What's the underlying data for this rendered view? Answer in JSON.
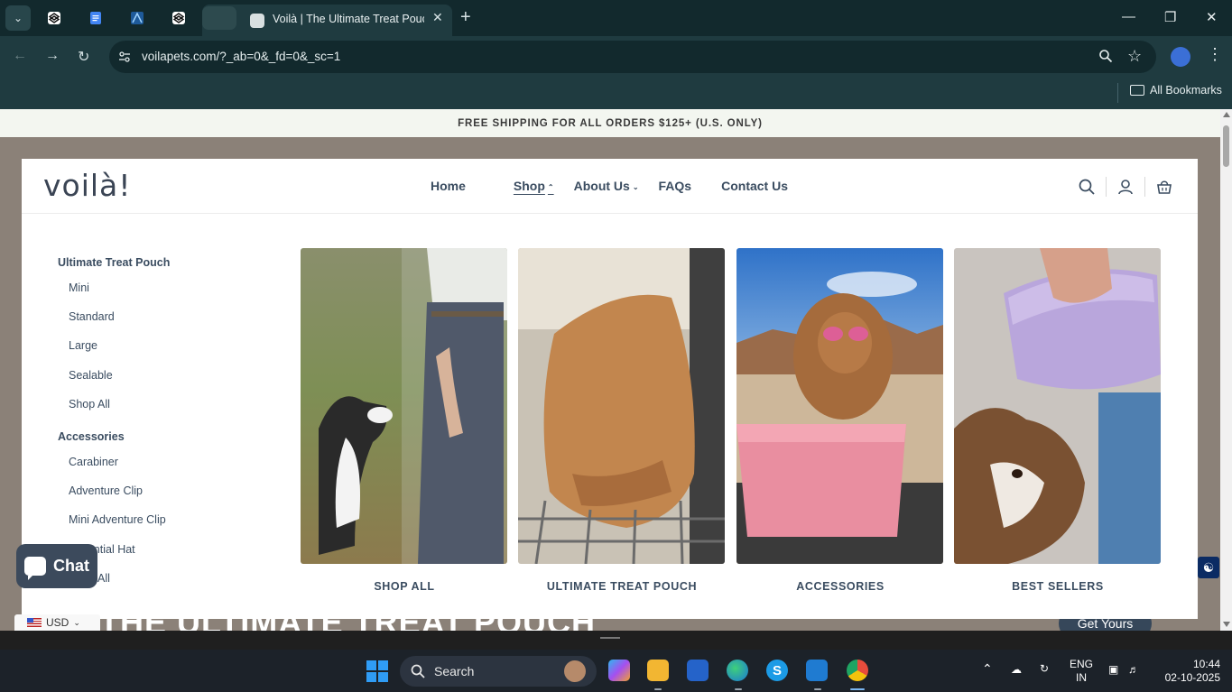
{
  "browser": {
    "active_tab_title": "Voilà | The Ultimate Treat Pouch",
    "url": "voilapets.com/?_ab=0&_fd=0&_sc=1",
    "bookmarks_label": "All Bookmarks",
    "accent_color": "#1f3b40"
  },
  "announcement": "FREE SHIPPING FOR ALL ORDERS $125+ (U.S. ONLY)",
  "header": {
    "logo": "voilà!",
    "nav": [
      {
        "label": "Home"
      },
      {
        "label": "Shop",
        "state": "open"
      },
      {
        "label": "About Us"
      },
      {
        "label": "FAQs"
      },
      {
        "label": "Contact Us"
      }
    ],
    "icons": [
      "search-icon",
      "account-icon",
      "cart-icon"
    ]
  },
  "mega_menu": {
    "groups": [
      {
        "heading": "Ultimate Treat Pouch",
        "links": [
          "Mini",
          "Standard",
          "Large",
          "Sealable",
          "Shop All"
        ]
      },
      {
        "heading": "Accessories",
        "links": [
          "Carabiner",
          "Adventure Clip",
          "Mini Adventure Clip",
          "Essential Hat",
          "Shop All"
        ]
      }
    ],
    "cards": [
      {
        "caption": "SHOP ALL",
        "image": "dog-looking-up-at-owner"
      },
      {
        "caption": "ULTIMATE TREAT POUCH",
        "image": "tan-pouch-in-dishwasher"
      },
      {
        "caption": "ACCESSORIES",
        "image": "dog-in-pink-pouch-desert"
      },
      {
        "caption": "BEST SELLERS",
        "image": "purple-pouch-with-dog"
      }
    ]
  },
  "hero": {
    "headline": "THE ULTIMATE TREAT POUCH",
    "cta": "Get Yours"
  },
  "widgets": {
    "chat_label": "Chat",
    "currency": "USD"
  },
  "taskbar": {
    "search_placeholder": "Search",
    "language": "ENG",
    "region": "IN",
    "time": "10:44",
    "date": "02-10-2025"
  }
}
